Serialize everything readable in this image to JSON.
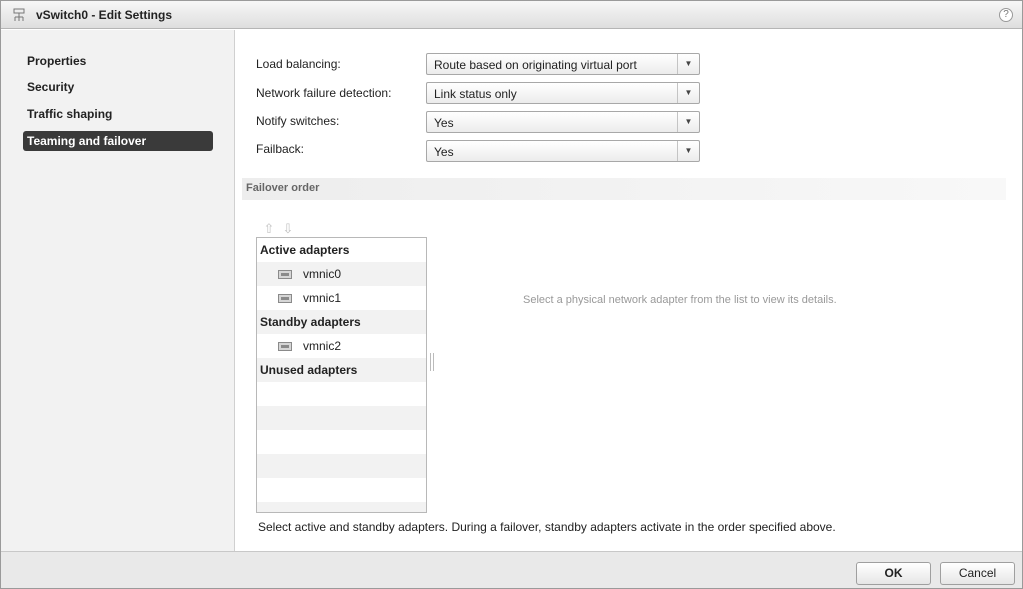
{
  "window": {
    "title": "vSwitch0 - Edit Settings",
    "help": "?"
  },
  "sidebar": {
    "items": [
      {
        "label": "Properties",
        "active": false
      },
      {
        "label": "Security",
        "active": false
      },
      {
        "label": "Traffic shaping",
        "active": false
      },
      {
        "label": "Teaming and failover",
        "active": true
      }
    ]
  },
  "form": {
    "load_balancing": {
      "label": "Load balancing:",
      "value": "Route based on originating virtual port"
    },
    "failure_detection": {
      "label": "Network failure detection:",
      "value": "Link status only"
    },
    "notify_switches": {
      "label": "Notify switches:",
      "value": "Yes"
    },
    "failback": {
      "label": "Failback:",
      "value": "Yes"
    }
  },
  "failover": {
    "title": "Failover order",
    "move_up_icon": "arrow-up",
    "move_down_icon": "arrow-down",
    "active_label": "Active adapters",
    "active": [
      "vmnic0",
      "vmnic1"
    ],
    "standby_label": "Standby adapters",
    "standby": [
      "vmnic2"
    ],
    "unused_label": "Unused adapters",
    "details_hint": "Select a physical network adapter from the list to view its details.",
    "footnote": "Select active and standby adapters. During a failover, standby adapters activate in the order specified above."
  },
  "footer": {
    "ok": "OK",
    "cancel": "Cancel"
  }
}
